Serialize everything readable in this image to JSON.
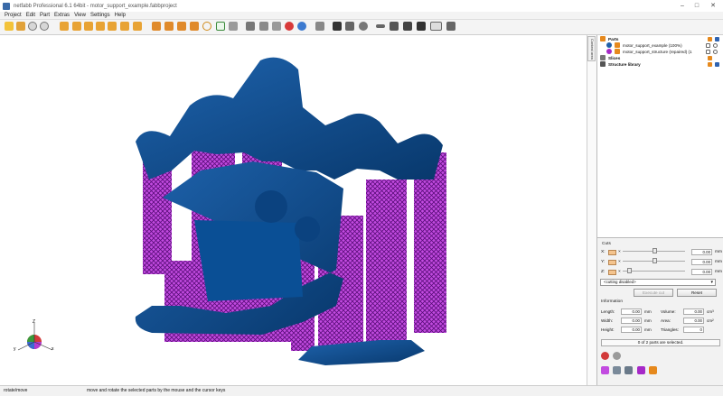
{
  "window": {
    "title": "netfabb Professional 6.1 64bit - motor_support_example.fabbproject"
  },
  "menu": [
    "Project",
    "Edit",
    "Part",
    "Extras",
    "View",
    "Settings",
    "Help"
  ],
  "side_tab": {
    "label": "Context area"
  },
  "tree": {
    "parts_label": "Parts",
    "items": [
      {
        "label": "motor_support_example (100%)"
      },
      {
        "label": "motor_support_structure (repaired) (1"
      }
    ],
    "slices_label": "Slices",
    "structure_label": "Structure library"
  },
  "cuts": {
    "label": "Cuts",
    "axes": [
      {
        "axis": "X:",
        "value": "0.00",
        "unit": "mm",
        "position": 0.48
      },
      {
        "axis": "Y:",
        "value": "0.00",
        "unit": "mm",
        "position": 0.48
      },
      {
        "axis": "Z:",
        "value": "0.00",
        "unit": "mm",
        "position": 0.07
      }
    ],
    "mode_select": "<cutting disabled>",
    "execute_label": "Execute cut",
    "reset_label": "Reset"
  },
  "information": {
    "label": "Information",
    "length": {
      "label": "Length:",
      "value": "0.00",
      "unit": "mm"
    },
    "width": {
      "label": "Width:",
      "value": "0.00",
      "unit": "mm"
    },
    "height": {
      "label": "Height:",
      "value": "0.00",
      "unit": "mm"
    },
    "volume": {
      "label": "Volume:",
      "value": "0.00",
      "unit": "cm³"
    },
    "area": {
      "label": "Area:",
      "value": "0.00",
      "unit": "cm²"
    },
    "triangles": {
      "label": "Triangles:",
      "value": "0"
    }
  },
  "selection_status": "0 of 2 parts are selected.",
  "statusbar": {
    "mode": "rotate/move",
    "hint": "move and rotate the selected parts by the mouse and the cursor keys"
  },
  "axis_gizmo": {
    "z": "Z",
    "y": "y",
    "x": "x"
  },
  "colors": {
    "part": "#0d4c8e",
    "support": "#a629c8",
    "accent_orange": "#e6891d"
  }
}
